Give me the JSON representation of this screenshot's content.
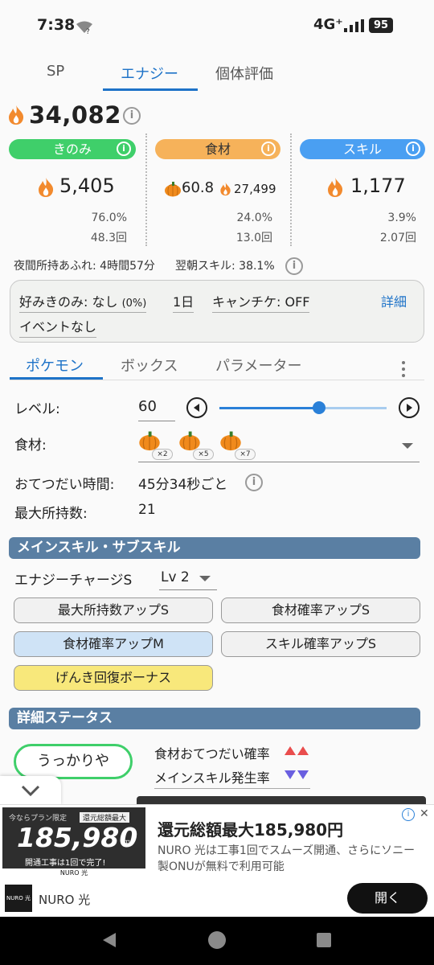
{
  "status": {
    "time": "7:38",
    "network": "4G⁺",
    "battery": "95"
  },
  "top_tabs": [
    "SP",
    "エナジー",
    "個体評価"
  ],
  "total_energy": "34,082",
  "categories": {
    "berry": {
      "label": "きのみ",
      "value": "5,405",
      "pct": "76.0%",
      "count": "48.3回",
      "color": "#3fcf6a"
    },
    "ingredient": {
      "label": "食材",
      "value_a": "60.8",
      "value_b": "27,499",
      "pct": "24.0%",
      "count": "13.0回",
      "color": "#f6b25a"
    },
    "skill": {
      "label": "スキル",
      "value": "1,177",
      "pct": "3.9%",
      "count": "2.07回",
      "color": "#4a9ff2"
    }
  },
  "notes": {
    "overflow": "夜間所持あふれ: 4時間57分",
    "next_skill": "翌朝スキル: 38.1%"
  },
  "settings": {
    "favorite_berry": "好みきのみ: なし",
    "favorite_pct": "(0%)",
    "days": "1日",
    "camp": "キャンチケ: OFF",
    "detail": "詳細",
    "event": "イベントなし"
  },
  "sub_tabs": [
    "ポケモン",
    "ボックス",
    "パラメーター"
  ],
  "pokemon": {
    "level_label": "レベル:",
    "level_value": "60",
    "level_fraction": 0.6,
    "ingredient_label": "食材:",
    "ingredients": [
      {
        "icon": "pumpkin-icon",
        "count": "×2"
      },
      {
        "icon": "pumpkin-icon",
        "count": "×5"
      },
      {
        "icon": "pumpkin-icon",
        "count": "×7"
      }
    ],
    "help_time_label": "おてつだい時間:",
    "help_time_value": "45分34秒ごと",
    "max_carry_label": "最大所持数:",
    "max_carry_value": "21"
  },
  "skills_section": {
    "title": "メインスキル・サブスキル",
    "main_skill": "エナジーチャージS",
    "level": "Lv 2",
    "subskills": [
      {
        "label": "最大所持数アップS",
        "style": "gray"
      },
      {
        "label": "食材確率アップS",
        "style": "gray"
      },
      {
        "label": "食材確率アップM",
        "style": "blue"
      },
      {
        "label": "スキル確率アップS",
        "style": "gray"
      },
      {
        "label": "げんき回復ボーナス",
        "style": "yellow"
      }
    ]
  },
  "detail_section": {
    "title": "詳細ステータス",
    "nature": "うっかりや",
    "up_stat": "食材おてつだい確率",
    "down_stat": "メインスキル発生率"
  },
  "ad": {
    "image_text_top_left": "今ならプラン限定",
    "image_text_top_right": "還元総額最大",
    "image_amount": "185,980",
    "image_unit": "円",
    "image_text_bottom": "開通工事は1回で完了!",
    "image_brand": "NURO 光",
    "title": "還元総額最大185,980円",
    "description": "NURO 光は工事1回でスムーズ開通、さらにソニー製ONUが無料で利用可能",
    "advertiser": "NURO 光",
    "logo_text": "NURO 光",
    "cta": "開く"
  }
}
